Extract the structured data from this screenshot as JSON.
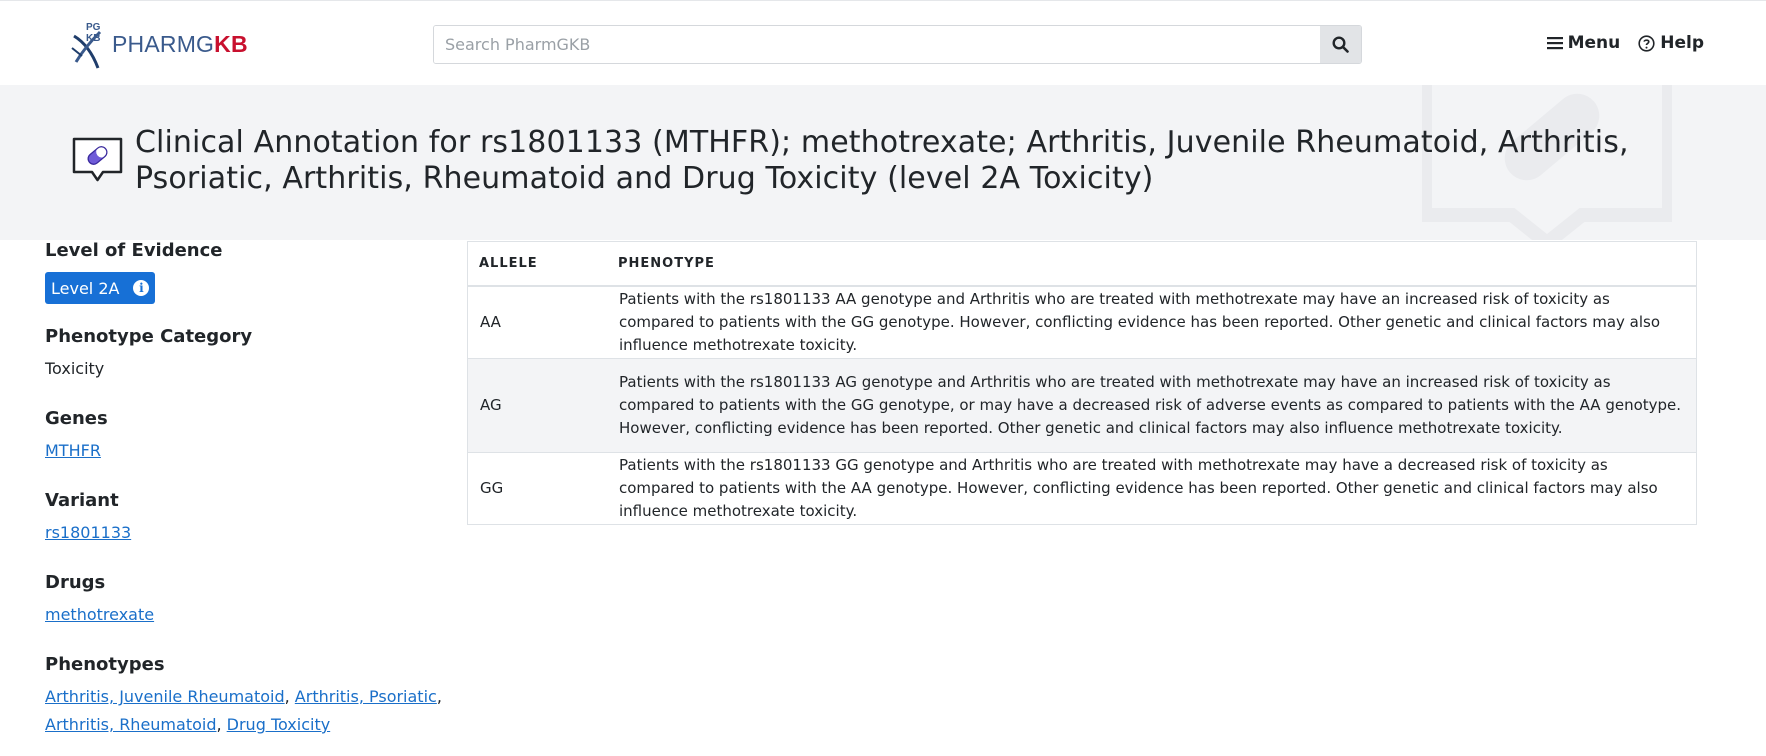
{
  "header": {
    "logo": {
      "mark_text": "PG KB",
      "brand_pharm": "PHARMG",
      "brand_kb": "KB"
    },
    "search": {
      "placeholder": "Search PharmGKB",
      "value": ""
    },
    "nav": [
      {
        "label": "Menu",
        "icon": "hamburger-icon"
      },
      {
        "label": "Help",
        "icon": "question-circle-icon"
      }
    ]
  },
  "page": {
    "title": "Clinical Annotation for rs1801133 (MTHFR); methotrexate; Arthritis, Juvenile Rheumatoid, Arthritis, Psoriatic, Arthritis, Rheumatoid and Drug Toxicity (level 2A Toxicity)",
    "title_icon": "pill-speech-bubble-icon"
  },
  "sidebar": {
    "level_of_evidence": {
      "label": "Level of Evidence",
      "badge": "Level 2A",
      "badge_color": "#1770d6"
    },
    "phenotype_category": {
      "label": "Phenotype Category",
      "value": "Toxicity"
    },
    "genes": {
      "label": "Genes",
      "items": [
        "MTHFR"
      ]
    },
    "variant": {
      "label": "Variant",
      "items": [
        "rs1801133"
      ]
    },
    "drugs": {
      "label": "Drugs",
      "items": [
        "methotrexate"
      ]
    },
    "phenotypes": {
      "label": "Phenotypes",
      "items": [
        "Arthritis, Juvenile Rheumatoid",
        "Arthritis, Psoriatic",
        "Arthritis, Rheumatoid",
        "Drug Toxicity"
      ]
    }
  },
  "table": {
    "columns": [
      "ALLELE",
      "PHENOTYPE"
    ],
    "rows": [
      {
        "allele": "AA",
        "phenotype": "Patients with the rs1801133 AA genotype and Arthritis who are treated with methotrexate may have an increased risk of toxicity as compared to patients with the GG genotype. However, conflicting evidence has been reported. Other genetic and clinical factors may also influence methotrexate toxicity."
      },
      {
        "allele": "AG",
        "phenotype": "Patients with the rs1801133 AG genotype and Arthritis who are treated with methotrexate may have an increased risk of toxicity as compared to patients with the GG genotype, or may have a decreased risk of adverse events as compared to patients with the AA genotype. However, conflicting evidence has been reported. Other genetic and clinical factors may also influence methotrexate toxicity."
      },
      {
        "allele": "GG",
        "phenotype": "Patients with the rs1801133 GG genotype and Arthritis who are treated with methotrexate may have a decreased risk of toxicity as compared to patients with the AA genotype. However, conflicting evidence has been reported. Other genetic and clinical factors may also influence methotrexate toxicity."
      }
    ]
  }
}
